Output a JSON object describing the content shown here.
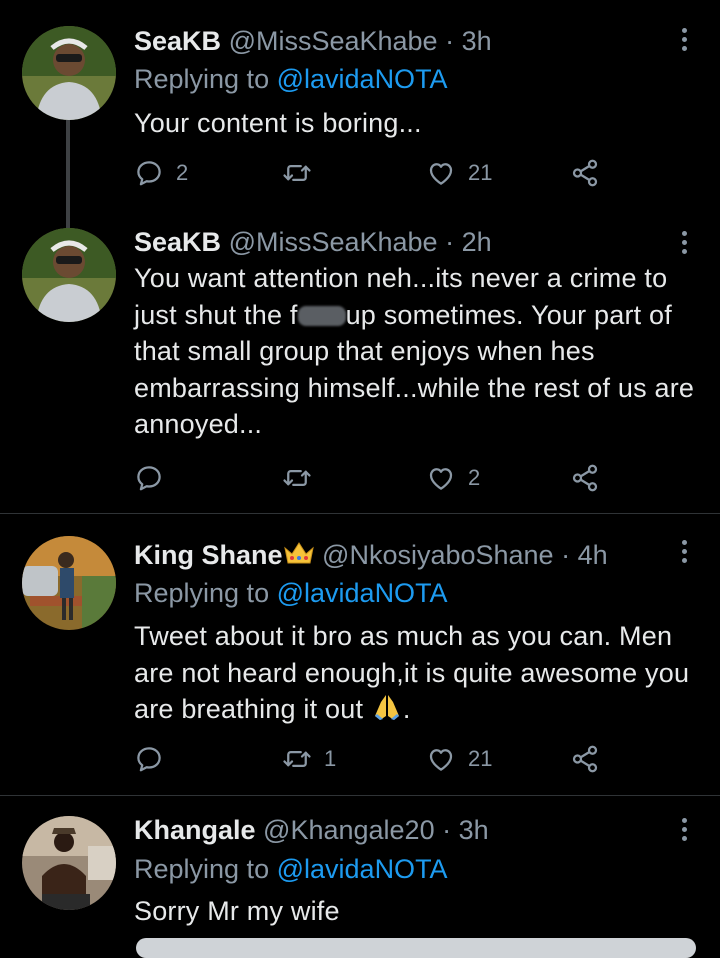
{
  "tweets": [
    {
      "name": "SeaKB",
      "handle": "@MissSeaKhabe",
      "time": "3h",
      "replying_prefix": "Replying to",
      "replying_to": "@lavidaNOTA",
      "text": "Your content is boring...",
      "replies": "2",
      "retweets": "",
      "likes": "21"
    },
    {
      "name": "SeaKB",
      "handle": "@MissSeaKhabe",
      "time": "2h",
      "text_line1": "You want attention neh...its never a crime to",
      "text_line2_a": "just shut the f",
      "text_line2_b": "up sometimes. Your part of",
      "text_rest": "that small group that enjoys when hes embarrassing himself...while the rest of us are annoyed...",
      "replies": "",
      "retweets": "",
      "likes": "2"
    },
    {
      "name": "King Shane",
      "handle": "@NkosiyaboShane",
      "time": "4h",
      "replying_prefix": "Replying to",
      "replying_to": "@lavidaNOTA",
      "text": "Tweet about it bro as much as you can. Men are not heard enough,it is quite awesome you are breathing it out",
      "text_end": ".",
      "replies": "",
      "retweets": "1",
      "likes": "21"
    },
    {
      "name": "Khangale",
      "handle": "@Khangale20",
      "time": "3h",
      "replying_prefix": "Replying to",
      "replying_to": "@lavidaNOTA",
      "text": "Sorry Mr my wife"
    }
  ],
  "separator": "·",
  "icons": [
    "reply-icon",
    "retweet-icon",
    "like-icon",
    "share-icon",
    "more-icon",
    "crown-emoji",
    "praying-hands-emoji"
  ],
  "colors": {
    "background": "#000000",
    "text": "#e7e9ea",
    "muted": "#8b98a5",
    "link": "#1d9bf0",
    "divider": "#2f3336"
  }
}
